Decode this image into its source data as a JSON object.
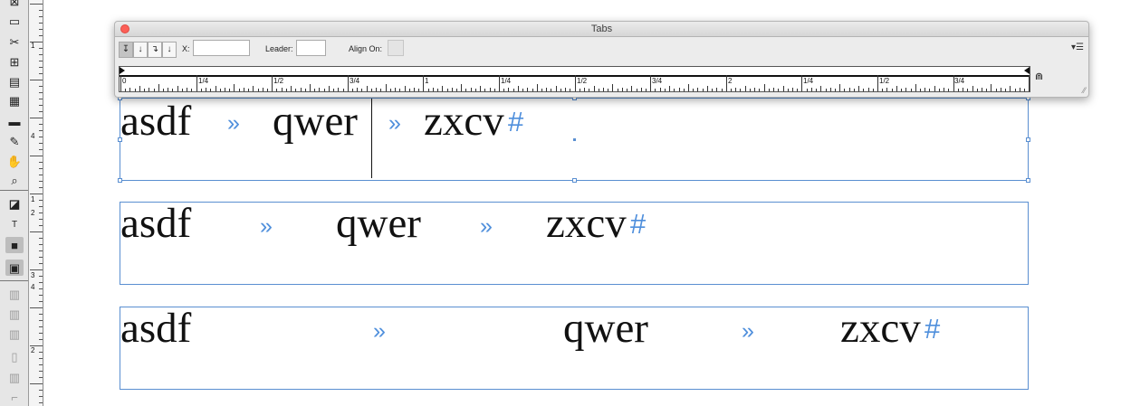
{
  "toolbox": {
    "tools": [
      {
        "name": "frame-tool-icon",
        "glyph": "⊠"
      },
      {
        "name": "rectangle-tool-icon",
        "glyph": "▭"
      },
      {
        "name": "scissors-tool-icon",
        "glyph": "✂"
      },
      {
        "name": "free-transform-tool-icon",
        "glyph": "⊞"
      },
      {
        "name": "gradient-tool-icon",
        "glyph": "▤"
      },
      {
        "name": "gradient-feather-tool-icon",
        "glyph": "▦"
      },
      {
        "name": "note-tool-icon",
        "glyph": "▬"
      },
      {
        "name": "eyedropper-tool-icon",
        "glyph": "✎"
      },
      {
        "name": "hand-tool-icon",
        "glyph": "✋"
      },
      {
        "name": "zoom-tool-icon",
        "glyph": "⌕"
      },
      {
        "name": "fill-stroke-icon",
        "glyph": "◪"
      },
      {
        "name": "formatting-affects-icon",
        "glyph": "T"
      },
      {
        "name": "apply-color-icon",
        "glyph": "■"
      },
      {
        "name": "screen-mode-icon",
        "glyph": "▣"
      }
    ]
  },
  "vertical_ruler": {
    "labels": [
      "1",
      "4",
      "1",
      "2",
      "3",
      "4",
      "2"
    ]
  },
  "tabs_panel": {
    "title": "Tabs",
    "align_buttons": [
      {
        "name": "left-justified-tab-button",
        "glyph": "↧"
      },
      {
        "name": "center-justified-tab-button",
        "glyph": "↓"
      },
      {
        "name": "right-justified-tab-button",
        "glyph": "↴"
      },
      {
        "name": "align-to-decimal-tab-button",
        "glyph": "↓"
      }
    ],
    "x_label": "X:",
    "x_value": "",
    "leader_label": "Leader:",
    "leader_value": "",
    "align_on_label": "Align On:",
    "align_on_value": "",
    "menu_glyph": "▾☰",
    "magnet_glyph": "⋒",
    "grip_glyph": "⁄⁄",
    "ruler_labels": [
      "0",
      "1/4",
      "1/2",
      "3/4",
      "1",
      "1/4",
      "1/2",
      "3/4",
      "2",
      "1/4",
      "1/2",
      "3/4"
    ]
  },
  "frames": [
    {
      "words": [
        "asdf",
        "qwer",
        "zxcv"
      ],
      "tab_glyph": "»",
      "end_glyph": "#"
    },
    {
      "words": [
        "asdf",
        "qwer",
        "zxcv"
      ],
      "tab_glyph": "»",
      "end_glyph": "#"
    },
    {
      "words": [
        "asdf",
        "qwer",
        "zxcv"
      ],
      "tab_glyph": "»",
      "end_glyph": "#"
    }
  ],
  "colors": {
    "frame_border": "#5a8fd1",
    "hidden_characters": "#4f8fdc",
    "close_button": "#fc5f57"
  }
}
